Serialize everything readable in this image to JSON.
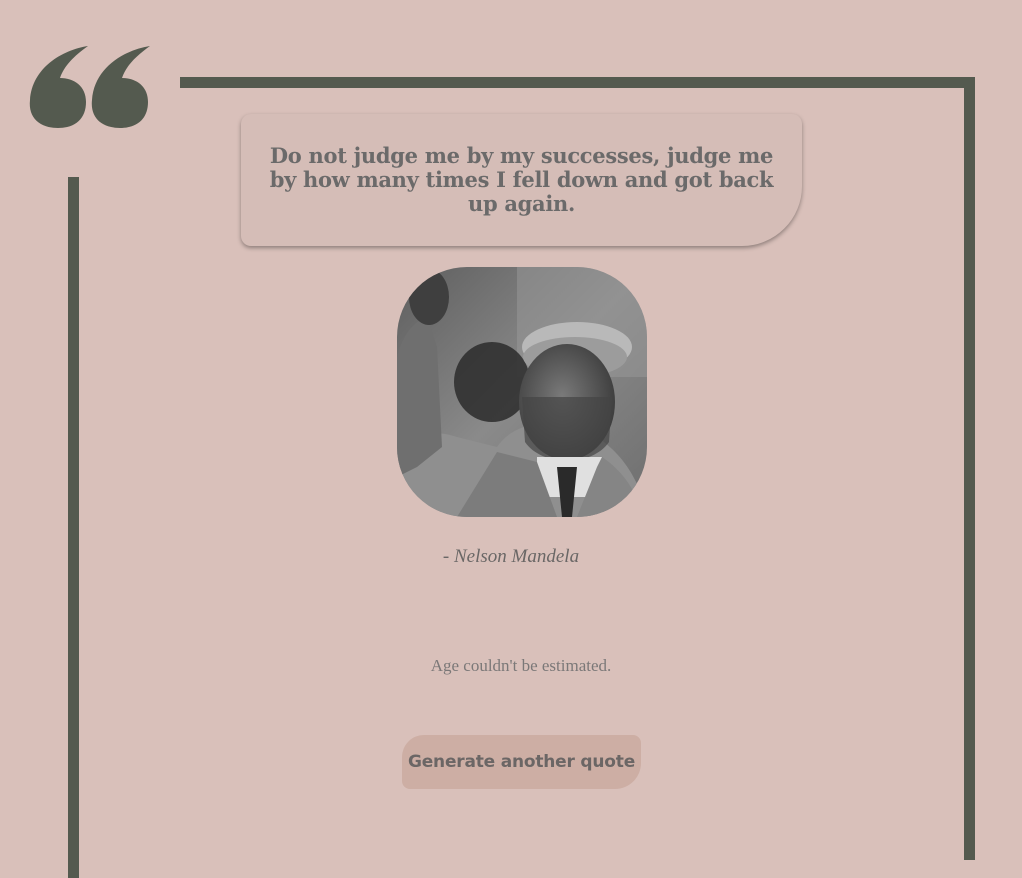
{
  "quote": {
    "text": "Do not judge me by my successes, judge me by how many times I fell down and got back up again.",
    "author": "- Nelson Mandela"
  },
  "age": {
    "message": "Age couldn't be estimated."
  },
  "actions": {
    "generate_label": "Generate another quote"
  },
  "colors": {
    "background": "#d9c0ba",
    "frame": "#545a4f",
    "bubble": "#d5bdb7",
    "button": "#cdaea4",
    "text": "#6b6a6a"
  },
  "icons": {
    "quote_mark": "quote-mark-icon"
  }
}
